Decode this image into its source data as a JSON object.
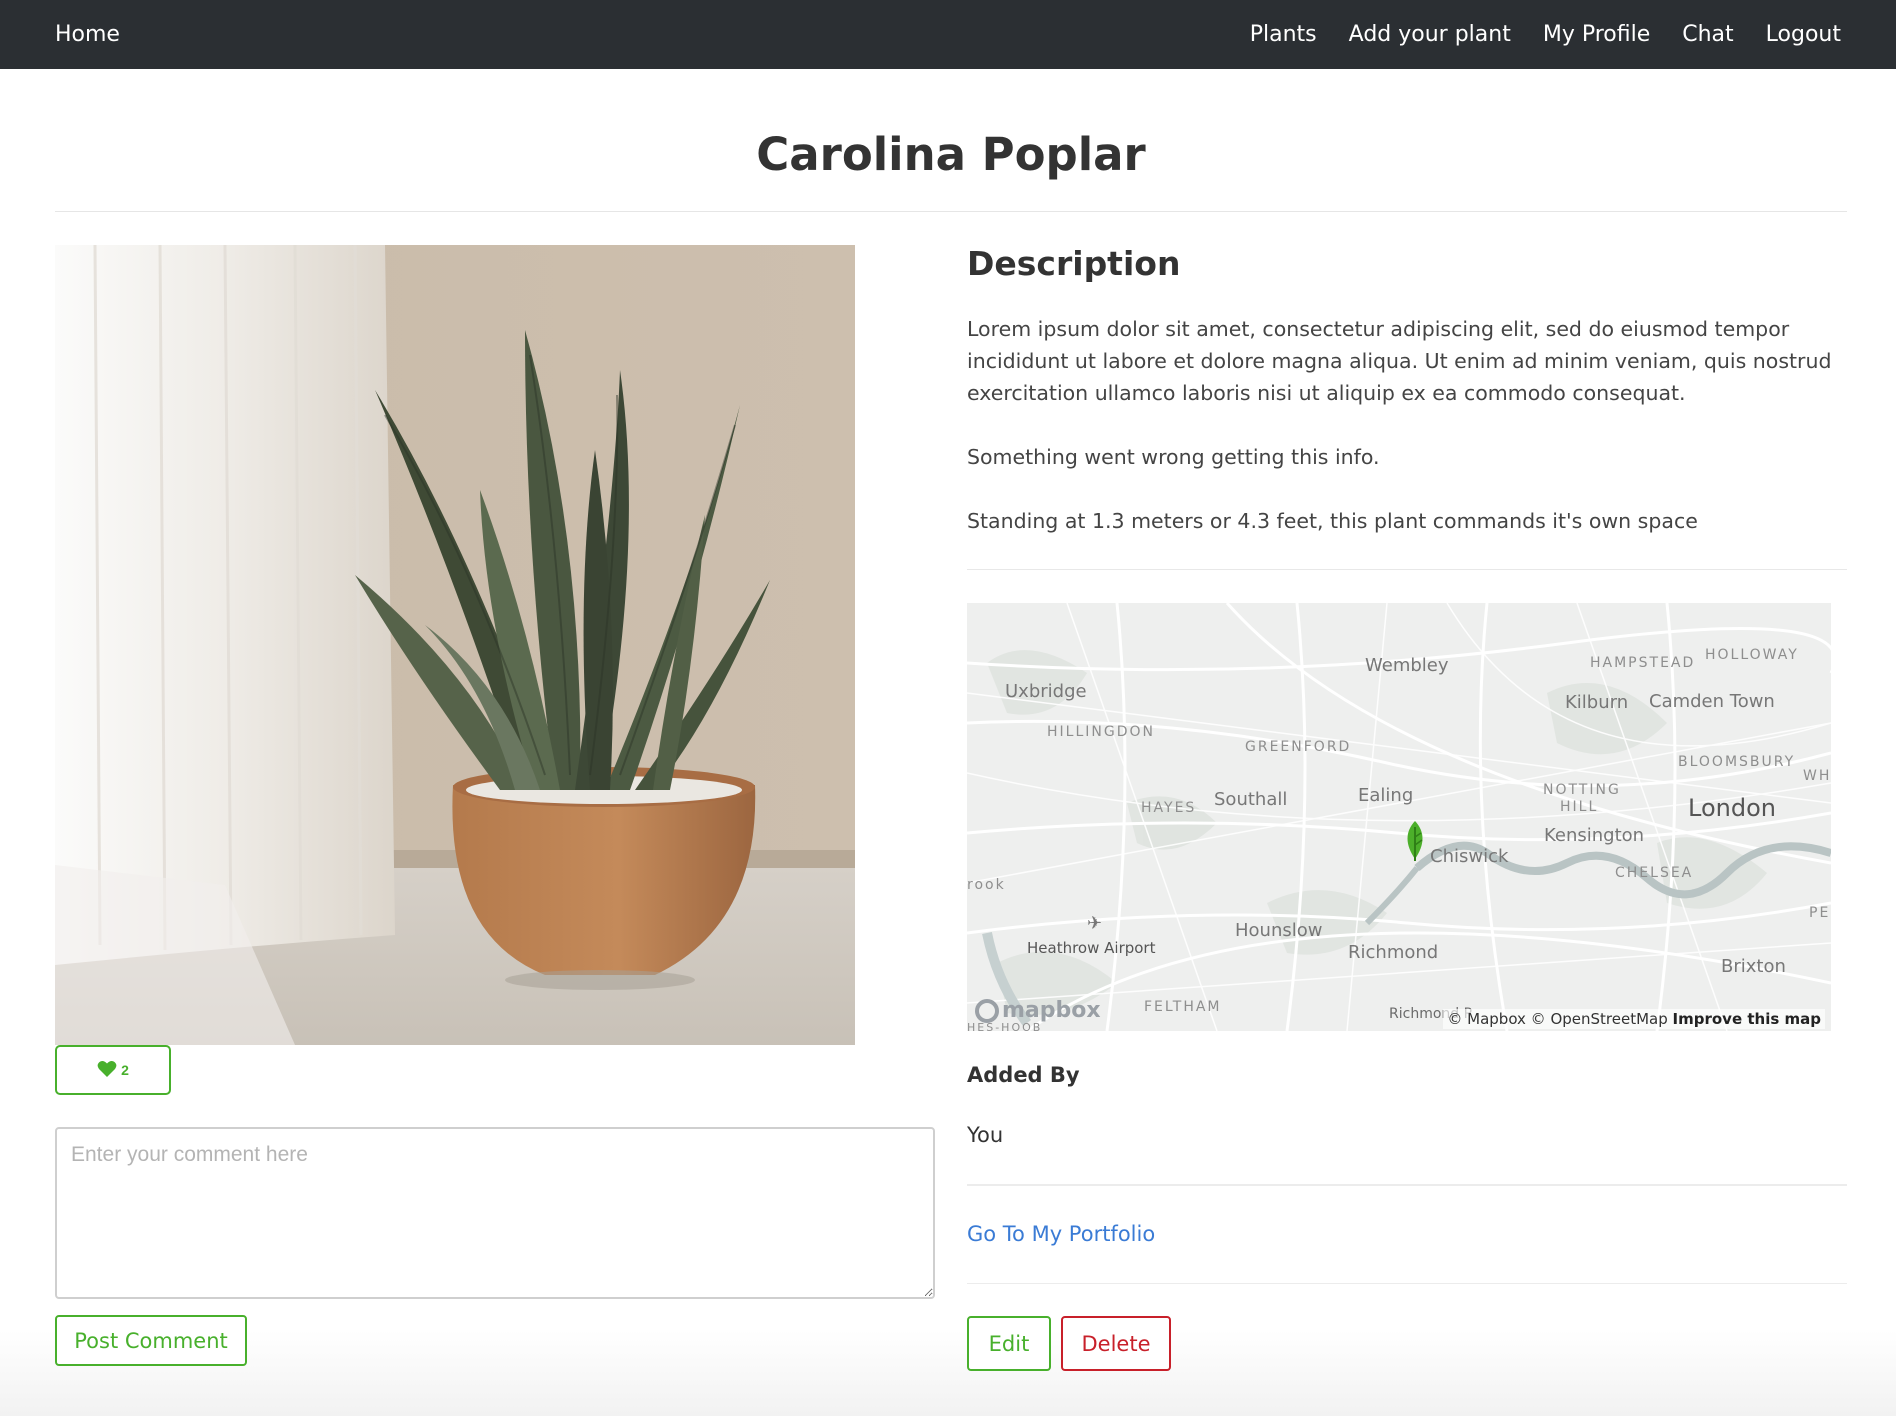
{
  "nav": {
    "home_label": "Home",
    "items": [
      {
        "label": "Plants"
      },
      {
        "label": "Add your plant"
      },
      {
        "label": "My Profile"
      },
      {
        "label": "Chat"
      },
      {
        "label": "Logout"
      }
    ]
  },
  "plant": {
    "name": "Carolina Poplar",
    "likes": "2",
    "like_icon": "heart-icon"
  },
  "description": {
    "heading": "Description",
    "paragraphs": [
      "Lorem ipsum dolor sit amet, consectetur adipiscing elit, sed do eiusmod tempor incididunt ut labore et dolore magna aliqua. Ut enim ad minim veniam, quis nostrud exercitation ullamco laboris nisi ut aliquip ex ea commodo consequat.",
      "Something went wrong getting this info.",
      "Standing at 1.3 meters or 4.3 feet, this plant commands it's own space"
    ]
  },
  "map": {
    "labels": {
      "wembley": "Wembley",
      "hampstead": "HAMPSTEAD",
      "holloway": "HOLLOWAY",
      "uxbridge": "Uxbridge",
      "kilburn": "Kilburn",
      "camden": "Camden Town",
      "hillingdon": "HILLINGDON",
      "greenford": "GREENFORD",
      "bloomsbury": "BLOOMSBURY",
      "whi": "WHI",
      "hayes": "HAYES",
      "southall": "Southall",
      "ealing": "Ealing",
      "notting": "NOTTING",
      "hill": "HILL",
      "london": "London",
      "kensington": "Kensington",
      "chiswick": "Chiswick",
      "rook": "rook",
      "chelsea": "CHELSEA",
      "pec": "PEC",
      "heathrow": "Heathrow Airport",
      "hounslow": "Hounslow",
      "richmond": "Richmond",
      "brixton": "Brixton",
      "feltham": "FELTHAM",
      "richmond_park": "Richmond P",
      "hes_hoob": "HES-HOOB"
    },
    "logo": "mapbox",
    "attribution": "© Mapbox © OpenStreetMap",
    "improve_link": "Improve this map",
    "marker_icon": "leaf-marker-icon",
    "marker_color": "#4caf2a"
  },
  "added_by": {
    "label": "Added By",
    "value": "You"
  },
  "links": {
    "portfolio": "Go To My Portfolio"
  },
  "comment": {
    "placeholder": "Enter your comment here",
    "post_label": "Post Comment"
  },
  "actions": {
    "edit_label": "Edit",
    "delete_label": "Delete"
  },
  "colors": {
    "navbar": "#2b2f33",
    "accent_green": "#48b02c",
    "danger_red": "#c8202a",
    "link_blue": "#3a7bd5"
  }
}
